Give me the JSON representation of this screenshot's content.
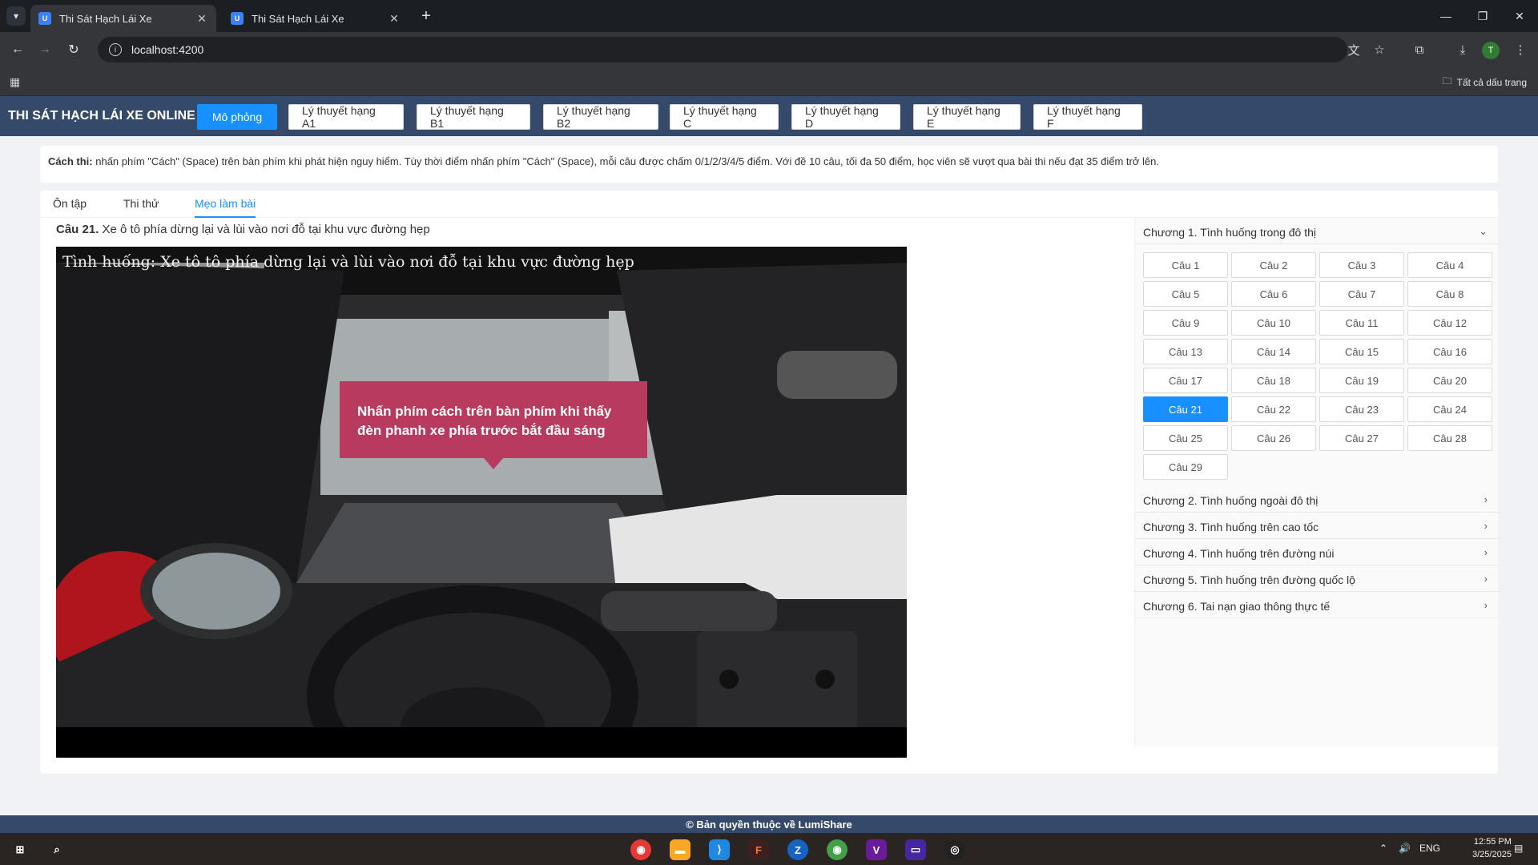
{
  "browser": {
    "tabs": [
      {
        "title": "Thi Sát Hạch Lái Xe",
        "active": true
      },
      {
        "title": "Thi Sát Hạch Lái Xe",
        "active": false
      }
    ],
    "url": "localhost:4200",
    "bookmarks_all": "Tất cả dấu trang",
    "profile_initial": "T"
  },
  "header": {
    "title": "THI SÁT HẠCH LÁI XE ONLINE",
    "nav": [
      "Mô phỏng",
      "Lý thuyết hạng A1",
      "Lý thuyết hạng B1",
      "Lý thuyết hạng B2",
      "Lý thuyết hạng C",
      "Lý thuyết hạng D",
      "Lý thuyết hạng E",
      "Lý thuyết hạng F"
    ]
  },
  "instruction": {
    "label": "Cách thi:",
    "text": " nhấn phím \"Cách\" (Space) trên bàn phím khi phát hiện nguy hiểm. Tùy thời điểm nhấn phím \"Cách\" (Space), mỗi câu được chấm 0/1/2/3/4/5 điểm. Với đề 10 câu, tối đa 50 điểm, học viên sẽ vượt qua bài thi nếu đạt 35 điểm trở lên."
  },
  "tabs": [
    "Ôn tập",
    "Thi thử",
    "Mẹo làm bài"
  ],
  "question": {
    "number": "Câu 21.",
    "text": " Xe ô tô phía dừng lại và lùi vào nơi đỗ tại khu vực đường hẹp"
  },
  "video": {
    "caption": "Tình huống: Xe tô tô phía dừng lại và lùi vào nơi đỗ tại khu vực đường hẹp",
    "hint_line1": "Nhấn phím cách trên bàn phím khi thấy",
    "hint_line2": "đèn phanh xe phía trước bắt đầu sáng"
  },
  "chapters": {
    "open_title": "Chương 1. Tình huống trong đô thị",
    "questions": [
      "Câu 1",
      "Câu 2",
      "Câu 3",
      "Câu 4",
      "Câu 5",
      "Câu 6",
      "Câu 7",
      "Câu 8",
      "Câu 9",
      "Câu 10",
      "Câu 11",
      "Câu 12",
      "Câu 13",
      "Câu 14",
      "Câu 15",
      "Câu 16",
      "Câu 17",
      "Câu 18",
      "Câu 19",
      "Câu 20",
      "Câu 21",
      "Câu 22",
      "Câu 23",
      "Câu 24",
      "Câu 25",
      "Câu 26",
      "Câu 27",
      "Câu 28",
      "Câu 29"
    ],
    "active_question": "Câu 21",
    "collapsed": [
      "Chương 2. Tình huống ngoài đô thị",
      "Chương 3. Tình huống trên cao tốc",
      "Chương 4. Tình huống trên đường núi",
      "Chương 5. Tình huống trên đường quốc lộ",
      "Chương 6. Tai nạn giao thông thực tế"
    ]
  },
  "footer": "© Bản quyền thuộc về LumiShare",
  "taskbar": {
    "lang": "ENG",
    "time": "12:55 PM",
    "date": "3/25/2025"
  },
  "colors": {
    "header_bg": "#354a6b",
    "primary": "#1890ff",
    "hint_bg": "#b83a5e"
  }
}
